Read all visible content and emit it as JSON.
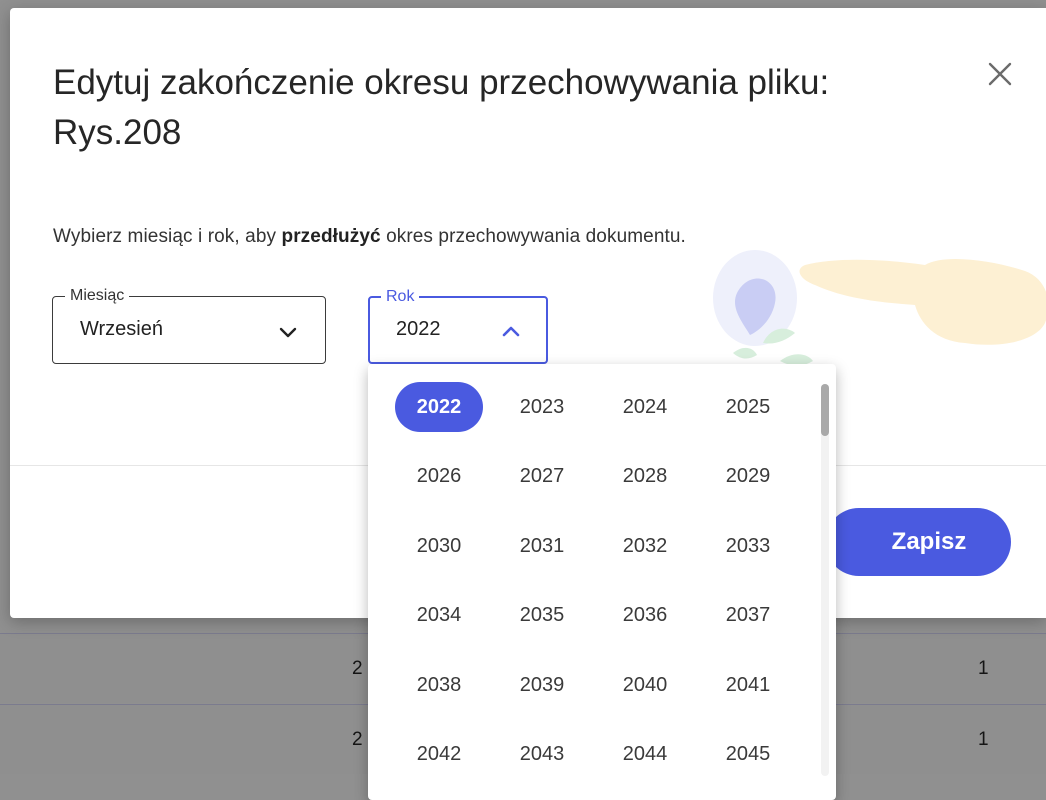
{
  "dialog": {
    "title": "Edytuj zakończenie okresu przechowywania pliku: Rys.208",
    "instruction_before": "Wybierz miesiąc i rok, aby ",
    "instruction_bold": "przedłużyć",
    "instruction_after": " okres przechowywania dokumentu.",
    "close_icon": "close-icon"
  },
  "month_field": {
    "label": "Miesiąc",
    "value": "Wrzesień",
    "icon": "chevron-down-icon"
  },
  "year_field": {
    "label": "Rok",
    "value": "2022",
    "icon": "chevron-up-icon"
  },
  "save_button": {
    "label": "Zapisz"
  },
  "year_dropdown": {
    "selected": "2022",
    "years": [
      "2022",
      "2023",
      "2024",
      "2025",
      "2026",
      "2027",
      "2028",
      "2029",
      "2030",
      "2031",
      "2032",
      "2033",
      "2034",
      "2035",
      "2036",
      "2037",
      "2038",
      "2039",
      "2040",
      "2041",
      "2042",
      "2043",
      "2044",
      "2045"
    ]
  },
  "background_table": {
    "rows": [
      {
        "col_a": "2",
        "col_b": "1"
      },
      {
        "col_a": "2",
        "col_b": "1"
      }
    ]
  },
  "colors": {
    "accent": "#4a5ae0",
    "overlay": "#8f8f8f",
    "text": "#262626"
  }
}
